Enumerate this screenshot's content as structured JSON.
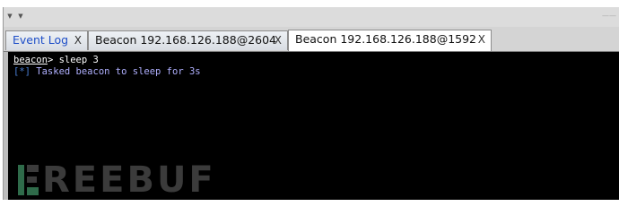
{
  "window": {
    "tabs": [
      {
        "label": "Event Log",
        "close": "X"
      },
      {
        "label": "Beacon 192.168.126.188@2604",
        "close": "X"
      },
      {
        "label": "Beacon 192.168.126.188@1592",
        "close": "X"
      }
    ],
    "active_tab": 2
  },
  "console": {
    "prompt_name": "beacon",
    "prompt_sep": ">",
    "command": " sleep 3",
    "output_marker": "[*]",
    "output_text": " Tasked beacon to sleep for 3s"
  },
  "watermark": {
    "text": "REEBUF"
  },
  "colors": {
    "console_bg": "#000000",
    "tab_active_bg": "#ffffff",
    "tab_label_blue": "#1f4fc8",
    "info_marker": "#4a7fd6"
  },
  "icons": {
    "tab_close": "close-icon",
    "dropdown": "chevron-down-icon",
    "watermark_logo": "freebuf-logo-icon"
  }
}
